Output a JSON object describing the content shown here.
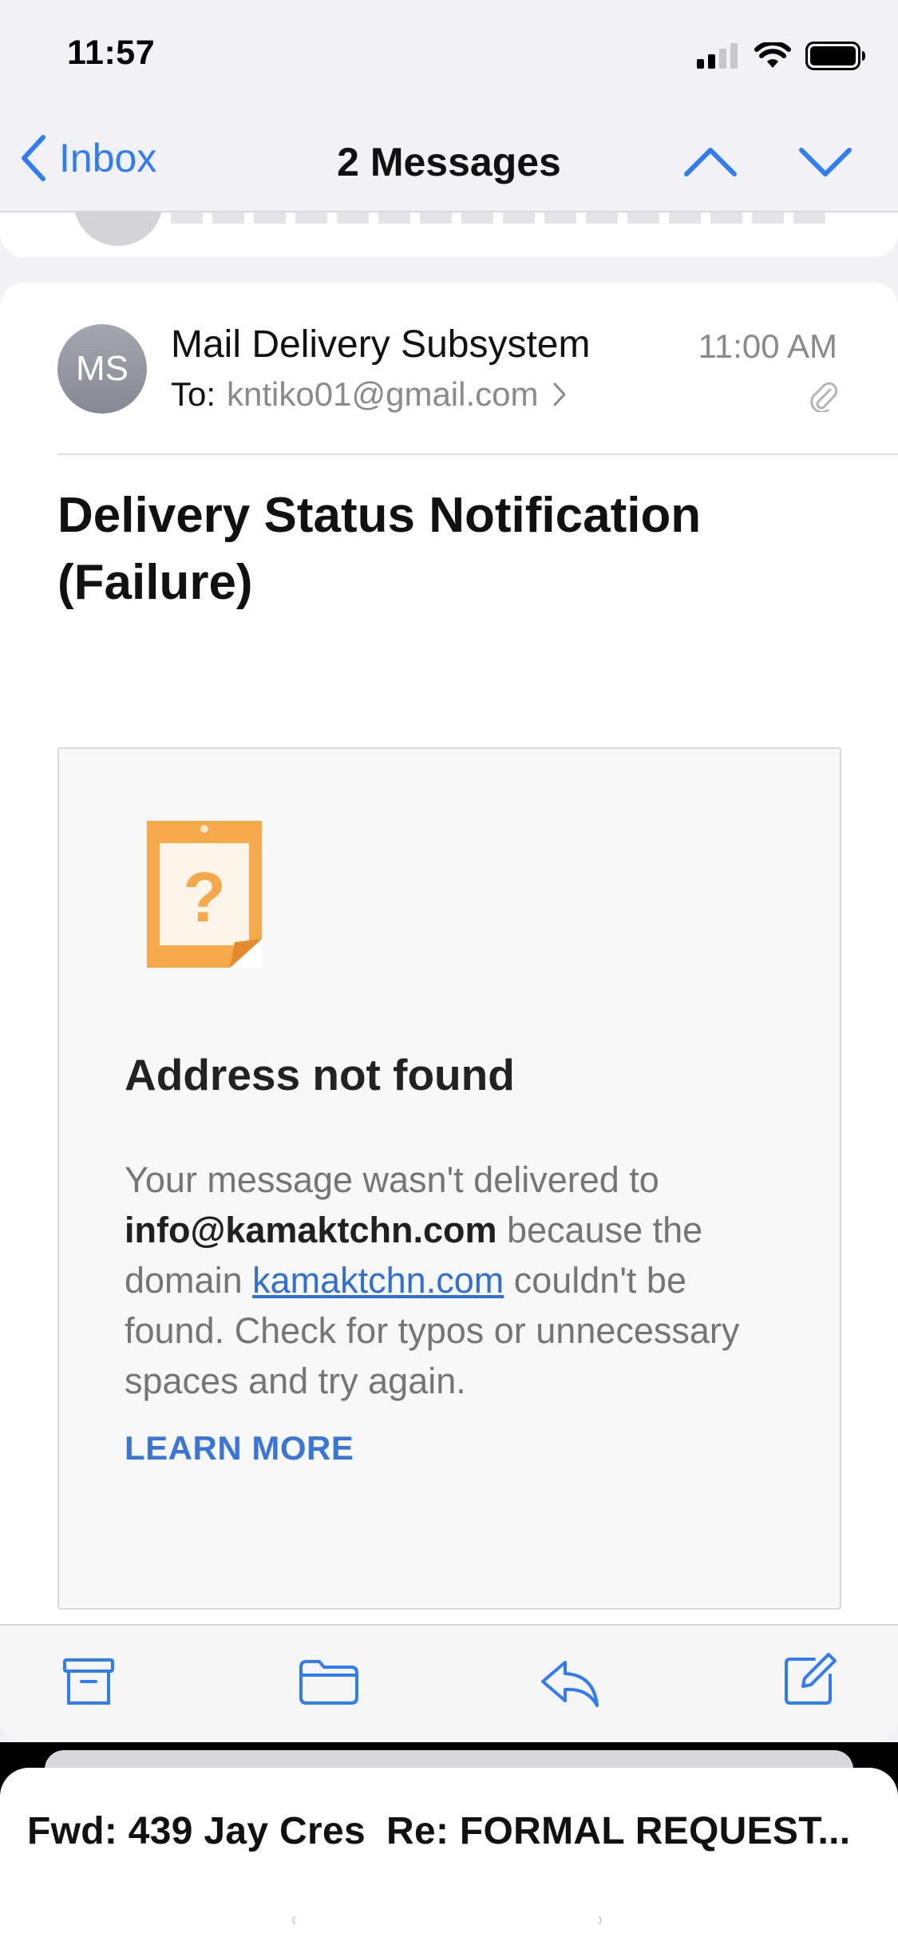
{
  "status_bar": {
    "time": "11:57",
    "icons": [
      "cellular-signal-icon",
      "wifi-icon",
      "battery-icon"
    ]
  },
  "nav": {
    "back_label": "Inbox",
    "title": "2 Messages",
    "accent_color": "#2f7cf6"
  },
  "message": {
    "avatar_initials": "MS",
    "sender": "Mail Delivery Subsystem",
    "time": "11:00 AM",
    "to_label": "To:",
    "to_address": "kntiko01@gmail.com",
    "subject": "Delivery Status Notification (Failure)"
  },
  "notice": {
    "icon": "question-note-icon",
    "heading": "Address not found",
    "body_part1": "Your message wasn't delivered to ",
    "body_email": "info@kamaktchn.com",
    "body_part2": " because the domain ",
    "body_link": "kamaktchn.com",
    "body_part3": " couldn't be found. Check for typos or unnecessary spaces and try again.",
    "learn_more": "LEARN MORE"
  },
  "toolbar": {
    "items": [
      "archive-icon",
      "folder-icon",
      "reply-icon",
      "compose-icon"
    ]
  },
  "drafts": {
    "item1": "Fwd: 439 Jay Cres",
    "item2": "Re: FORMAL REQUEST..."
  }
}
